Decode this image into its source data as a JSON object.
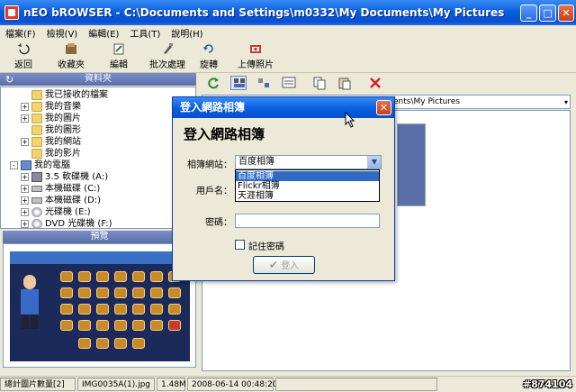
{
  "window": {
    "title": "nEO bROWSER - C:\\Documents and Settings\\m0332\\My Documents\\My Pictures",
    "min": "_",
    "max": "□",
    "close": "✕"
  },
  "menu": [
    "檔案(F)",
    "檢視(V)",
    "編輯(E)",
    "工具(T)",
    "說明(H)"
  ],
  "toolbar": {
    "back": "返回",
    "favorites": "收藏夾",
    "edit": "編輯",
    "batch": "批次處理",
    "rotate": "旋轉",
    "upload": "上傳照片"
  },
  "folder_panel": {
    "header": "資料夾",
    "items": [
      {
        "label": "我已接收的檔案",
        "expander": ""
      },
      {
        "label": "我的音樂",
        "expander": "+"
      },
      {
        "label": "我的圖片",
        "expander": "+"
      },
      {
        "label": "我的圖形",
        "expander": ""
      },
      {
        "label": "我的網站",
        "expander": "+"
      },
      {
        "label": "我的影片",
        "expander": ""
      },
      {
        "label": "我的電腦",
        "expander": "-"
      },
      {
        "label": "3.5 軟碟機 (A:)",
        "expander": "+"
      },
      {
        "label": "本機磁碟 (C:)",
        "expander": "+"
      },
      {
        "label": "本機磁碟 (D:)",
        "expander": "+"
      },
      {
        "label": "光碟機 (E:)",
        "expander": "+"
      },
      {
        "label": "DVD 光碟機 (F:)",
        "expander": "+"
      }
    ]
  },
  "preview_panel": {
    "header": "預覽"
  },
  "address": {
    "value": "ents\\My Pictures"
  },
  "dialog": {
    "title": "登入網路相簿",
    "close": "✕",
    "heading": "登入網路相簿",
    "site_label": "相簿網站：",
    "site_value": "百度相簿",
    "options": [
      "百度相簿",
      "Flickr相簿",
      "天涯相簿"
    ],
    "user_label": "用戶名：",
    "password_label": "密碼：",
    "remember_label": "記住密碼",
    "login_button": "登入"
  },
  "status": {
    "count": "總計圖片數量[2]",
    "filename": "IMG0035A(1).jpg",
    "size": "1.48M",
    "date": "2008-06-14 00:48:20"
  },
  "watermark": "#874104"
}
